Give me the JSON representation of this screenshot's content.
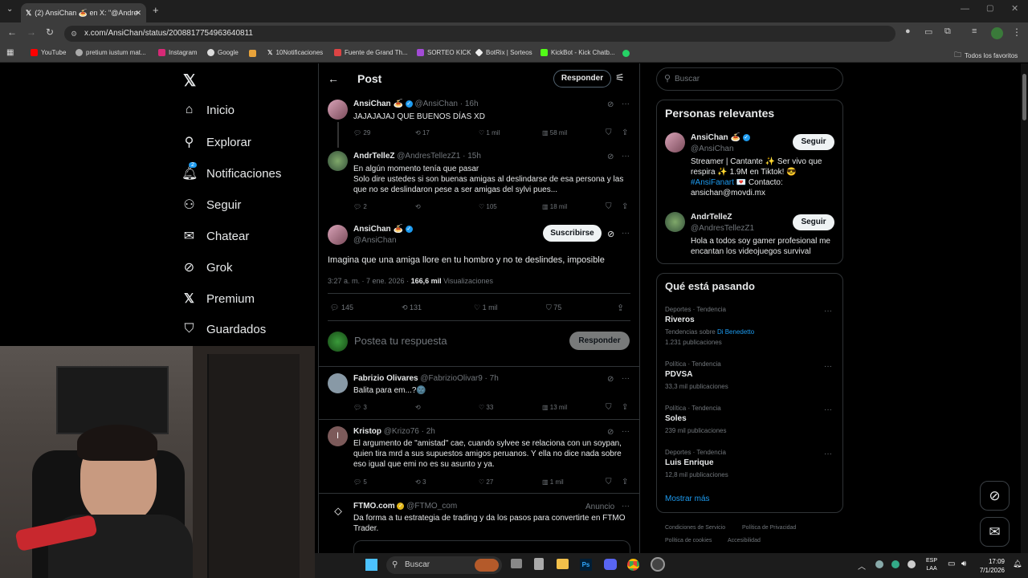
{
  "browser": {
    "tab_title": "(2) AnsiChan 🍝 en X: \"@Andre",
    "url": "x.com/AnsiChan/status/2008817754963640811",
    "bookmarks": [
      "YouTube",
      "pretium iustum mat...",
      "Instagram",
      "Google",
      "10Notificaciones",
      "Fuente de Grand Th...",
      "SORTEO KICK",
      "BotRix | Sorteos",
      "KickBot - Kick Chatb...",
      "Todos los favoritos"
    ]
  },
  "nav": {
    "items": [
      "Inicio",
      "Explorar",
      "Notificaciones",
      "Seguir",
      "Chatear",
      "Grok",
      "Premium",
      "Guardados"
    ],
    "notif_badge": "2"
  },
  "header": {
    "title": "Post",
    "reply_button": "Responder"
  },
  "tweets": [
    {
      "name": "AnsiChan 🍝",
      "handle": "@AnsiChan · 16h",
      "text": "JAJAJAJAJ QUE BUENOS DÍAS XD",
      "replies": "29",
      "retweets": "17",
      "likes": "1 mil",
      "views": "58 mil"
    },
    {
      "name": "AndrTelleZ",
      "handle": "@AndresTellezZ1 · 15h",
      "text": "En algún momento tenía que pasar\nSolo dire ustedes si son buenas amigas al deslindarse de esa persona y las que no se deslindaron pese a ser amigas del sylvi pues...",
      "replies": "2",
      "retweets": "",
      "likes": "105",
      "views": "18 mil"
    }
  ],
  "main_post": {
    "name": "AnsiChan 🍝",
    "handle": "@AnsiChan",
    "subscribe": "Suscribirse",
    "text": "Imagina que una amiga llore en tu hombro y no te deslindes, imposible",
    "time": "3:27 a. m. · 7 ene. 2026 · ",
    "views_count": "166,6 mil",
    "views_label": " Visualizaciones",
    "replies": "145",
    "retweets": "131",
    "likes": "1 mil",
    "bookmarks": "75"
  },
  "reply_box": {
    "placeholder": "Postea tu respuesta",
    "button": "Responder"
  },
  "replies": [
    {
      "name": "Fabrizio Olivares",
      "handle": "@FabrizioOlivar9 · 7h",
      "text": "Balita para em...?🌚",
      "replies": "3",
      "retweets": "",
      "likes": "33",
      "views": "13 mil"
    },
    {
      "name": "Kristop",
      "handle": "@Krizo76 · 2h",
      "text": "El argumento de \"amistad\" cae, cuando sylvee se relaciona con un soypan, quien tira mrd a sus supuestos amigos peruanos. Y ella  no dice nada sobre eso igual que emi no es su asunto y ya.",
      "replies": "5",
      "retweets": "3",
      "likes": "27",
      "views": "1 mil",
      "initial": "I"
    },
    {
      "name": "FTMO.com",
      "handle": "@FTMO_com",
      "ad": "Anuncio",
      "text": "Da forma a tu estrategia de trading y da los pasos para convertirte en FTMO Trader."
    }
  ],
  "search": {
    "placeholder": "Buscar"
  },
  "relevant": {
    "title": "Personas relevantes",
    "people": [
      {
        "name": "AnsiChan 🍝",
        "handle": "@AnsiChan",
        "follow": "Seguir",
        "bio": "Streamer | Cantante ✨ Ser vivo que respira ✨ 1.9M en Tiktok! 😎",
        "hashtag": "#AnsiFanart",
        "bio2": " 💌 Contacto: ansichan@movdi.mx"
      },
      {
        "name": "AndrTelleZ",
        "handle": "@AndresTellezZ1",
        "follow": "Seguir",
        "bio": "Hola a todos soy gamer profesional me encantan los videojuegos survival"
      }
    ]
  },
  "trends": {
    "title": "Qué está pasando",
    "items": [
      {
        "cat": "Deportes · Tendencia",
        "name": "Riveros",
        "extra": "Tendencias sobre ",
        "extra_link": "Di Benedetto",
        "count": "1.231 publicaciones"
      },
      {
        "cat": "Política · Tendencia",
        "name": "PDVSA",
        "count": "33,3 mil publicaciones"
      },
      {
        "cat": "Política · Tendencia",
        "name": "Soles",
        "count": "239 mil publicaciones"
      },
      {
        "cat": "Deportes · Tendencia",
        "name": "Luis Enrique",
        "count": "12,8 mil publicaciones"
      }
    ],
    "more": "Mostrar más"
  },
  "footer": {
    "links": [
      "Condiciones de Servicio",
      "Política de Privacidad",
      "Política de cookies",
      "Accesibilidad"
    ]
  },
  "taskbar": {
    "search": "Buscar",
    "lang1": "ESP",
    "lang2": "LAA",
    "time": "17:09",
    "date": "7/1/2026"
  },
  "colors": {
    "accent": "#1d9bf0",
    "bg": "#000000",
    "border": "#2f3336",
    "muted": "#71767b"
  }
}
